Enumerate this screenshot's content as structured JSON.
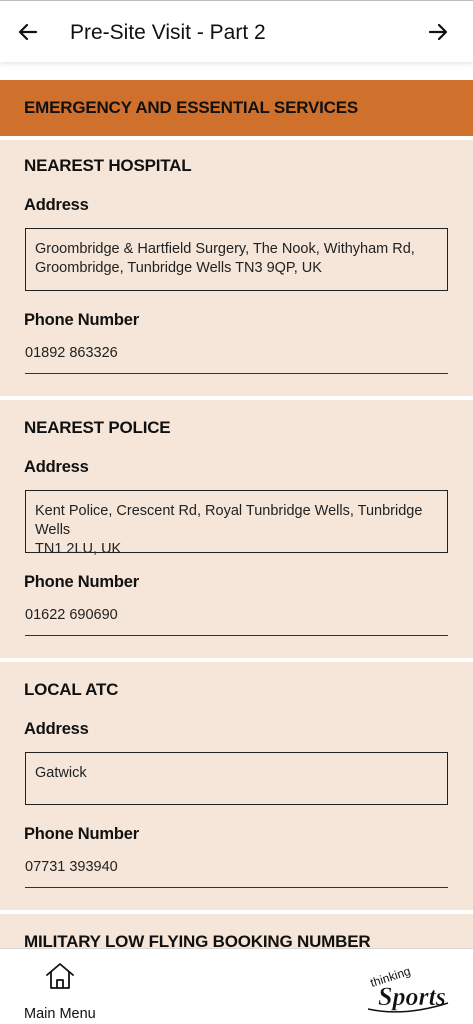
{
  "header": {
    "title": "Pre-Site Visit - Part 2",
    "back_icon": "arrow-left-icon",
    "forward_icon": "arrow-right-icon"
  },
  "section": {
    "title": "EMERGENCY AND ESSENTIAL SERVICES",
    "color": "#d0702d"
  },
  "cards": [
    {
      "title": "NEAREST HOSPITAL",
      "address_label": "Address",
      "address_line1": "Groombridge & Hartfield Surgery, The Nook, Withyham Rd,",
      "address_line2": "Groombridge, Tunbridge Wells TN3 9QP, UK",
      "phone_label": "Phone Number",
      "phone": "01892 863326"
    },
    {
      "title": "NEAREST POLICE",
      "address_label": "Address",
      "address_line1": "Kent Police, Crescent Rd, Royal Tunbridge Wells, Tunbridge Wells",
      "address_line2": "TN1 2LU, UK",
      "phone_label": "Phone Number",
      "phone": "01622 690690"
    },
    {
      "title": "LOCAL ATC",
      "address_label": "Address",
      "address_line1": "Gatwick",
      "address_line2": "",
      "phone_label": "Phone Number",
      "phone": "07731 393940"
    },
    {
      "title": "MILITARY LOW FLYING BOOKING NUMBER"
    }
  ],
  "card_color": "#f5e6d9",
  "footer": {
    "main_menu_label": "Main Menu",
    "home_icon": "home-icon",
    "logo_top": "thinking",
    "logo_bottom": "Sports"
  }
}
